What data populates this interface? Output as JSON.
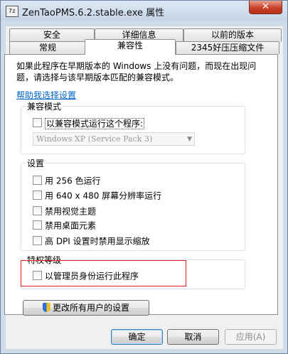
{
  "window": {
    "title": "ZenTaoPMS.6.2.stable.exe 属性",
    "icon_text": "7z",
    "close_glyph": "✕"
  },
  "tabs": {
    "row1": [
      "安全",
      "详细信息",
      "以前的版本"
    ],
    "row2": [
      "常规",
      "兼容性",
      "2345好压压缩文件"
    ],
    "active": "兼容性"
  },
  "description": "如果此程序在早期版本的 Windows 上没有问题，而现在出现问题，请选择与该早期版本匹配的兼容模式。",
  "help_link": "帮助我选择设置",
  "compat_mode": {
    "title": "兼容模式",
    "checkbox_label": "以兼容模式运行这个程序:",
    "checked": false,
    "select_value": "Windows XP (Service Pack 3)",
    "select_enabled": false
  },
  "settings": {
    "title": "设置",
    "options": [
      {
        "label": "用 256 色运行",
        "checked": false
      },
      {
        "label": "用 640 x 480 屏幕分辨率运行",
        "checked": false
      },
      {
        "label": "禁用视觉主题",
        "checked": false
      },
      {
        "label": "禁用桌面元素",
        "checked": false
      },
      {
        "label": "高 DPI 设置时禁用显示缩放",
        "checked": false
      }
    ]
  },
  "privilege": {
    "title": "特权等级",
    "checkbox_label": "以管理员身份运行此程序",
    "checked": false
  },
  "all_users_button": "更改所有用户的设置",
  "buttons": {
    "ok": "确定",
    "cancel": "取消",
    "apply": "应用(A)"
  },
  "colors": {
    "link": "#0066cc",
    "highlight_box": "#e02020",
    "close_button": "#c8412a"
  }
}
